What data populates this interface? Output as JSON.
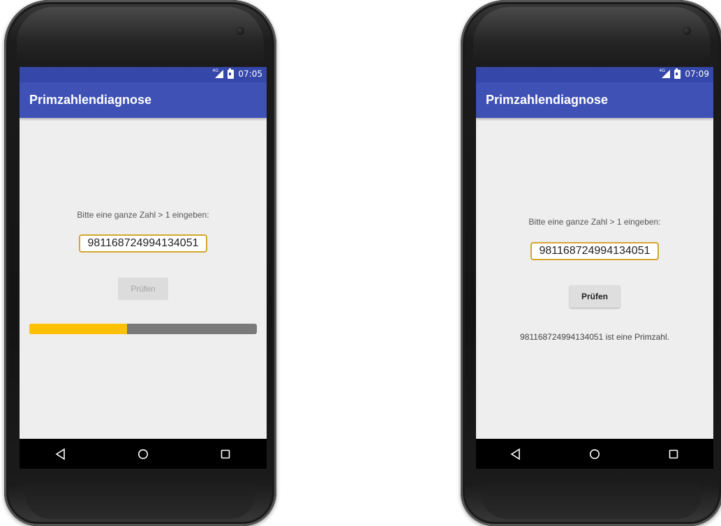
{
  "screens": [
    {
      "status_time": "07:05",
      "network": "4G",
      "app_title": "Primzahlendiagnose",
      "prompt": "Bitte eine ganze Zahl > 1 eingeben:",
      "input_value": "981168724994134051",
      "button_label": "Prüfen",
      "button_state": "disabled",
      "progress": 0.43,
      "result": ""
    },
    {
      "status_time": "07:09",
      "network": "4G",
      "app_title": "Primzahlendiagnose",
      "prompt": "Bitte eine ganze Zahl > 1 eingeben:",
      "input_value": "981168724994134051",
      "button_label": "Prüfen",
      "button_state": "enabled",
      "result": "981168724994134051 ist eine Primzahl."
    }
  ],
  "nav_icons": [
    "back-icon",
    "home-icon",
    "recents-icon"
  ],
  "colors": {
    "status_bar": "#3547a8",
    "app_bar": "#3f51b5",
    "progress_fill": "#ffc107",
    "progress_track": "#7a7a7a",
    "input_border": "#d4a531"
  }
}
